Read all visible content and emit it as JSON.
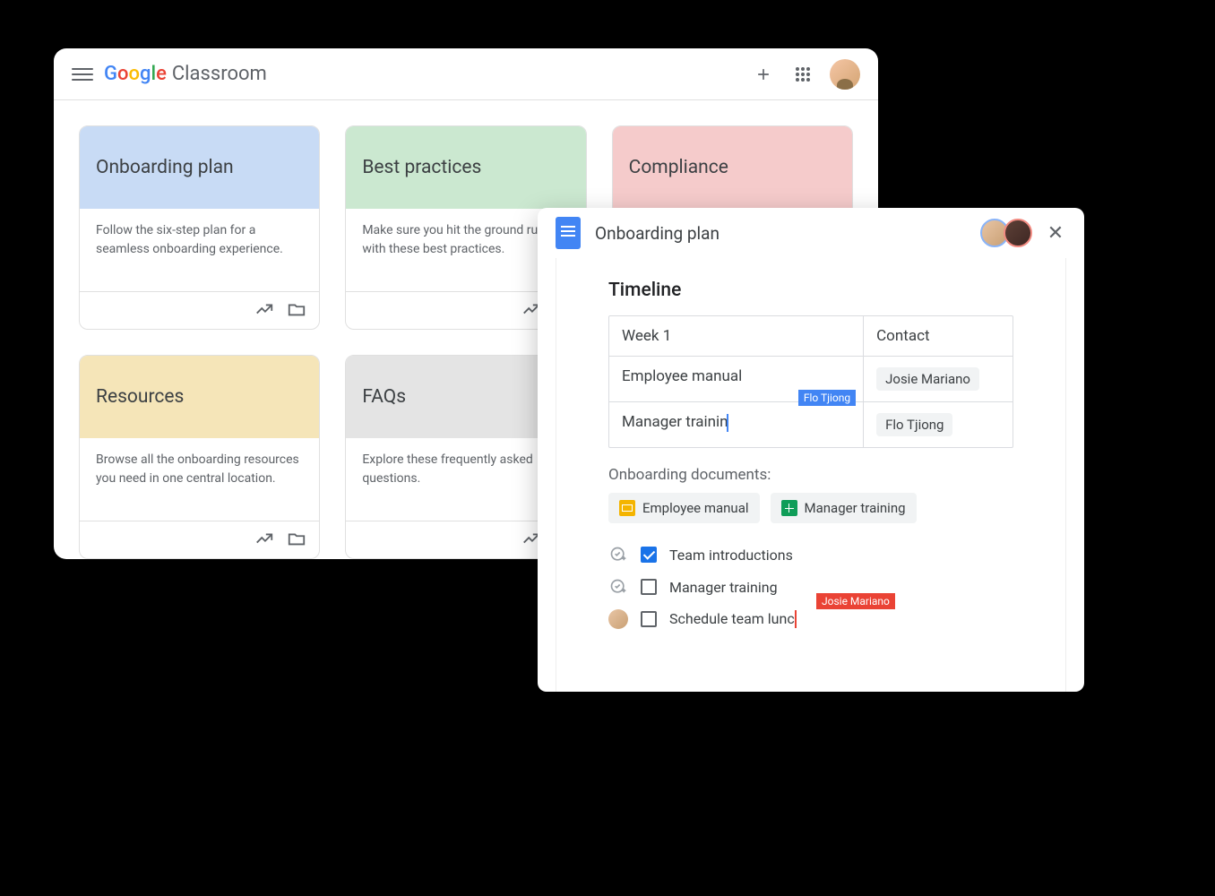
{
  "classroom": {
    "app_name": "Classroom",
    "cards": [
      {
        "title": "Onboarding plan",
        "desc": "Follow the six-step plan for a seamless onboarding experience.",
        "color": "bg-blue"
      },
      {
        "title": "Best practices",
        "desc": "Make sure you hit the ground running with these best practices.",
        "color": "bg-green"
      },
      {
        "title": "Compliance",
        "desc": "",
        "color": "bg-pink"
      },
      {
        "title": "Resources",
        "desc": "Browse all the onboarding resources you need in one central location.",
        "color": "bg-yellow"
      },
      {
        "title": "FAQs",
        "desc": "Explore these frequently asked questions.",
        "color": "bg-gray"
      }
    ]
  },
  "docs": {
    "title": "Onboarding plan",
    "timeline_heading": "Timeline",
    "table": {
      "header_left": "Week 1",
      "header_right": "Contact",
      "rows": [
        {
          "task": "Employee manual",
          "contact": "Josie Mariano"
        },
        {
          "task": "Manager trainin",
          "contact": "Flo Tjiong"
        }
      ]
    },
    "cursor_tag_blue": "Flo Tjiong",
    "onboarding_docs_label": "Onboarding documents:",
    "doc_chips": [
      {
        "label": "Employee manual",
        "icon": "slides"
      },
      {
        "label": "Manager training",
        "icon": "sheets"
      }
    ],
    "checklist": [
      {
        "text": "Team introductions",
        "checked": true,
        "indicator": "add-check"
      },
      {
        "text": "Manager training",
        "checked": false,
        "indicator": "add-check"
      },
      {
        "text": "Schedule team lunc",
        "checked": false,
        "indicator": "avatar"
      }
    ],
    "cursor_tag_red": "Josie Mariano"
  }
}
